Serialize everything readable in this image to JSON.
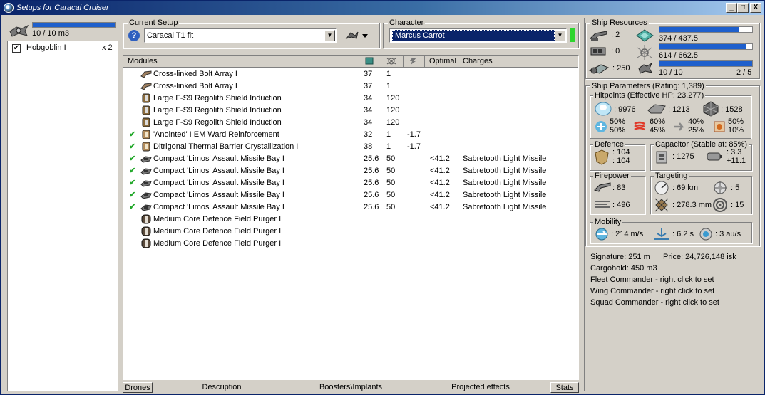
{
  "window": {
    "title": "Setups for Caracal Cruiser",
    "min": "_",
    "max": "□",
    "close": "X"
  },
  "drones": {
    "bandwidth": "10 / 10 m3",
    "bandwidth_frac": 1.0,
    "items": [
      {
        "name": "Hobgoblin I",
        "qty": "x 2",
        "checked": true
      }
    ]
  },
  "setup": {
    "label": "Current Setup",
    "value": "Caracal T1 fit",
    "help": "?"
  },
  "character": {
    "label": "Character",
    "value": "Marcus Carrot"
  },
  "modules": {
    "headers": [
      "Modules",
      "",
      "",
      "",
      "Optimal",
      "Charges"
    ],
    "rows": [
      {
        "check": "",
        "name": "Cross-linked Bolt Array I",
        "cpu": "37",
        "pg": "1",
        "cap": "",
        "optimal": "",
        "charge": "",
        "icon": "bolt"
      },
      {
        "check": "",
        "name": "Cross-linked Bolt Array I",
        "cpu": "37",
        "pg": "1",
        "cap": "",
        "optimal": "",
        "charge": "",
        "icon": "bolt"
      },
      {
        "check": "",
        "name": "Large F-S9 Regolith Shield Induction",
        "cpu": "34",
        "pg": "120",
        "cap": "",
        "optimal": "",
        "charge": "",
        "icon": "shield"
      },
      {
        "check": "",
        "name": "Large F-S9 Regolith Shield Induction",
        "cpu": "34",
        "pg": "120",
        "cap": "",
        "optimal": "",
        "charge": "",
        "icon": "shield"
      },
      {
        "check": "",
        "name": "Large F-S9 Regolith Shield Induction",
        "cpu": "34",
        "pg": "120",
        "cap": "",
        "optimal": "",
        "charge": "",
        "icon": "shield"
      },
      {
        "check": "✔",
        "name": "'Anointed' I EM Ward Reinforcement",
        "cpu": "32",
        "pg": "1",
        "cap": "-1.7",
        "optimal": "",
        "charge": "",
        "icon": "ward"
      },
      {
        "check": "✔",
        "name": "Ditrigonal Thermal Barrier Crystallization I",
        "cpu": "38",
        "pg": "1",
        "cap": "-1.7",
        "optimal": "",
        "charge": "",
        "icon": "ward"
      },
      {
        "check": "✔",
        "name": "Compact 'Limos' Assault Missile Bay I",
        "cpu": "25.6",
        "pg": "50",
        "cap": "",
        "optimal": "<41.2",
        "charge": "Sabretooth Light Missile",
        "icon": "missile"
      },
      {
        "check": "✔",
        "name": "Compact 'Limos' Assault Missile Bay I",
        "cpu": "25.6",
        "pg": "50",
        "cap": "",
        "optimal": "<41.2",
        "charge": "Sabretooth Light Missile",
        "icon": "missile"
      },
      {
        "check": "✔",
        "name": "Compact 'Limos' Assault Missile Bay I",
        "cpu": "25.6",
        "pg": "50",
        "cap": "",
        "optimal": "<41.2",
        "charge": "Sabretooth Light Missile",
        "icon": "missile"
      },
      {
        "check": "✔",
        "name": "Compact 'Limos' Assault Missile Bay I",
        "cpu": "25.6",
        "pg": "50",
        "cap": "",
        "optimal": "<41.2",
        "charge": "Sabretooth Light Missile",
        "icon": "missile"
      },
      {
        "check": "✔",
        "name": "Compact 'Limos' Assault Missile Bay I",
        "cpu": "25.6",
        "pg": "50",
        "cap": "",
        "optimal": "<41.2",
        "charge": "Sabretooth Light Missile",
        "icon": "missile"
      },
      {
        "check": "",
        "name": "Medium Core Defence Field Purger I",
        "cpu": "",
        "pg": "",
        "cap": "",
        "optimal": "",
        "charge": "",
        "icon": "rig"
      },
      {
        "check": "",
        "name": "Medium Core Defence Field Purger I",
        "cpu": "",
        "pg": "",
        "cap": "",
        "optimal": "",
        "charge": "",
        "icon": "rig"
      },
      {
        "check": "",
        "name": "Medium Core Defence Field Purger I",
        "cpu": "",
        "pg": "",
        "cap": "",
        "optimal": "",
        "charge": "",
        "icon": "rig"
      }
    ]
  },
  "tabs": [
    "Drones",
    "Description",
    "Boosters\\Implants",
    "Projected effects",
    "Stats"
  ],
  "resources": {
    "label": "Ship Resources",
    "hardpoints_turret": ": 2",
    "hardpoints_launcher": ": 0",
    "calibration": ": 250",
    "cpu": "374 / 437.5",
    "cpu_frac": 0.855,
    "powergrid": "614 / 662.5",
    "pg_frac": 0.927,
    "drones": "10 / 10",
    "drones_active": "2 / 5",
    "drones_frac": 1.0
  },
  "params": {
    "label": "Ship Parameters (Rating: 1,389)",
    "hp": {
      "label": "Hitpoints (Effective HP: 23,277)",
      "shield": ": 9976",
      "armor": ": 1213",
      "hull": ": 1528",
      "em": [
        "50%",
        "50%"
      ],
      "thermal": [
        "60%",
        "45%"
      ],
      "kinetic": [
        "40%",
        "25%"
      ],
      "explosive": [
        "50%",
        "10%"
      ]
    },
    "defence": {
      "label": "Defence",
      "a": ": 104",
      "b": ": 104"
    },
    "capacitor": {
      "label": "Capacitor (Stable at: 85%)",
      "amount": ": 1275",
      "a": ": 3.3",
      "b": "+11.1"
    },
    "firepower": {
      "label": "Firepower",
      "a": ": 83",
      "b": ": 496"
    },
    "targeting": {
      "label": "Targeting",
      "range": ": 69 km",
      "targets": ": 5",
      "scan": ": 278.3 mm",
      "sensor": ": 15"
    },
    "mobility": {
      "label": "Mobility",
      "speed": ": 214 m/s",
      "align": ": 6.2 s",
      "warp": ": 3 au/s"
    }
  },
  "info": {
    "signature": "Signature: 251 m",
    "price": "Price: 24,726,148 isk",
    "cargo": "Cargohold: 450 m3",
    "fleet": "Fleet Commander - right click to set",
    "wing": "Wing Commander - right click to set",
    "squad": "Squad Commander - right click to set"
  }
}
